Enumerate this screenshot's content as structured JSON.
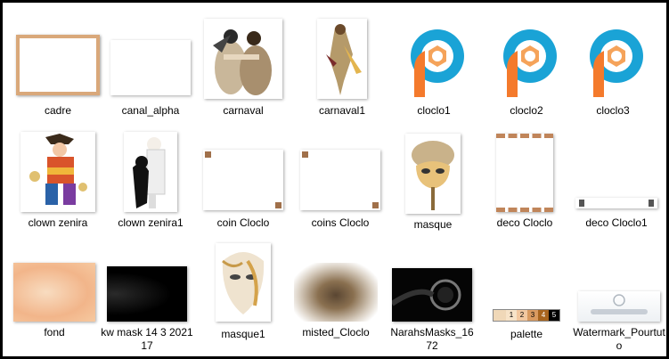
{
  "files": [
    {
      "name": "cadre"
    },
    {
      "name": "canal_alpha"
    },
    {
      "name": "carnaval"
    },
    {
      "name": "carnaval1"
    },
    {
      "name": "cloclo1"
    },
    {
      "name": "cloclo2"
    },
    {
      "name": "cloclo3"
    },
    {
      "name": "clown zenira"
    },
    {
      "name": "clown zenira1"
    },
    {
      "name": "coin Cloclo"
    },
    {
      "name": "coins Cloclo"
    },
    {
      "name": "masque"
    },
    {
      "name": "deco Cloclo"
    },
    {
      "name": "deco Cloclo1"
    },
    {
      "name": "fond"
    },
    {
      "name": "kw mask 14 3 2021 17"
    },
    {
      "name": "masque1"
    },
    {
      "name": "misted_Cloclo"
    },
    {
      "name": "NarahsMasks_1672"
    },
    {
      "name": "palette"
    },
    {
      "name": "Watermark_Pourtuto"
    }
  ],
  "palette_swatches": [
    "1",
    "2",
    "3",
    "4",
    "5"
  ],
  "colors": {
    "frame": "#000000",
    "background": "#ffffff",
    "accent_blue": "#1aa3d6",
    "accent_orange": "#f08a3c"
  }
}
